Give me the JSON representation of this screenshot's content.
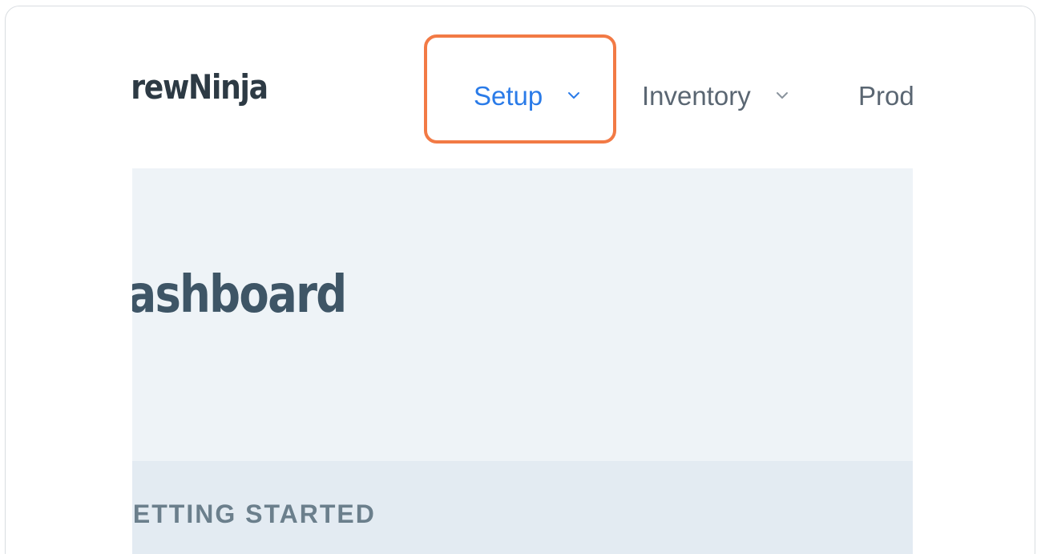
{
  "brand": {
    "logo_text": "BrewNinja"
  },
  "nav": {
    "items": [
      {
        "label": "Setup",
        "active": true,
        "has_dropdown": true
      },
      {
        "label": "Inventory",
        "active": false,
        "has_dropdown": true
      },
      {
        "label": "Prod",
        "active": false,
        "has_dropdown": false
      }
    ]
  },
  "hero": {
    "title": "Dashboard"
  },
  "section": {
    "label": "GETTING STARTED"
  },
  "colors": {
    "active_nav": "#2a7be8",
    "nav_text": "#5a6672",
    "highlight_border": "#f27a45",
    "hero_bg": "#eef3f7",
    "section_bg": "#e3ebf2"
  },
  "icons": {
    "dropdown": "chevron-down-icon"
  }
}
